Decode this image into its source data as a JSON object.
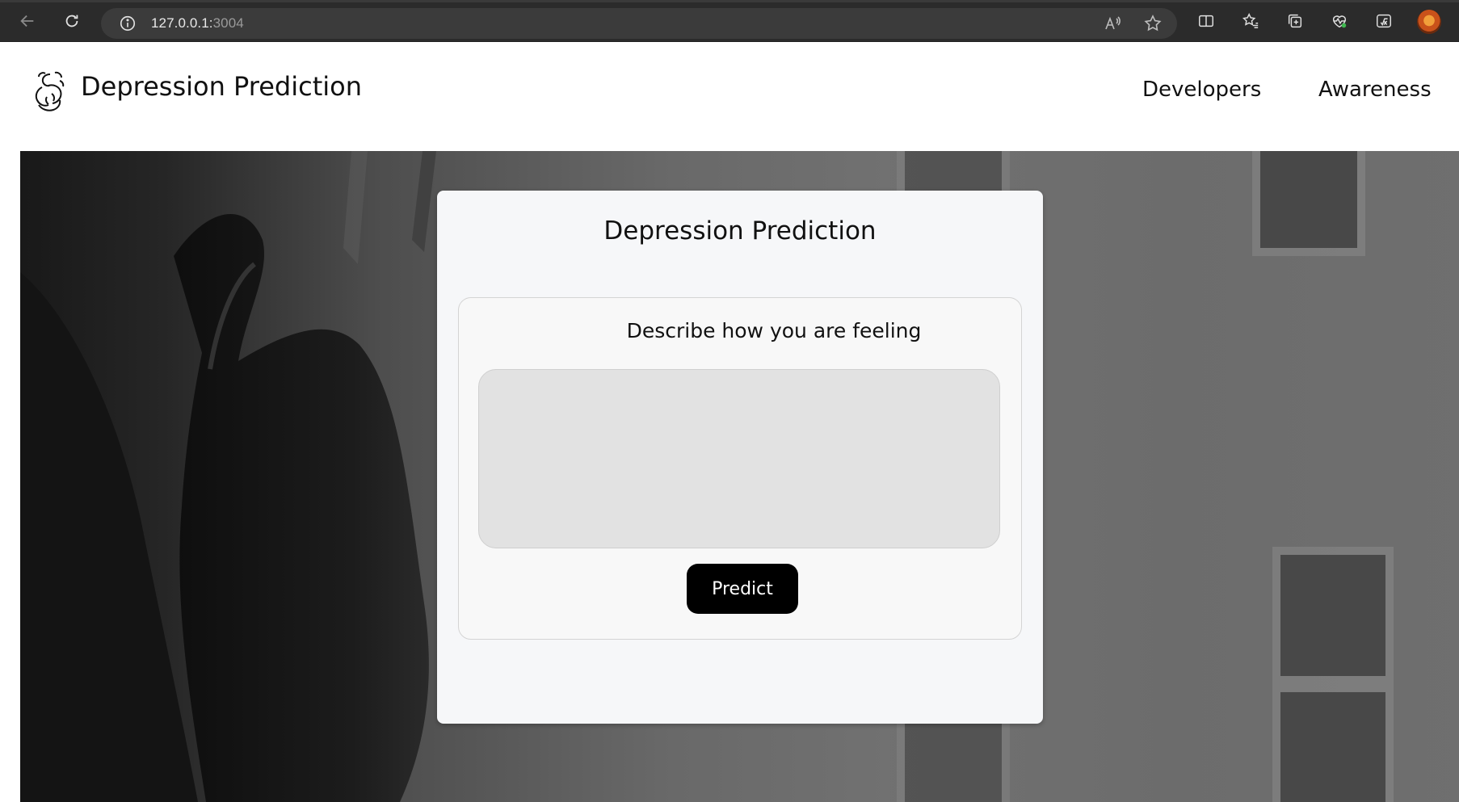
{
  "browser": {
    "url_host": "127.0.0.1:",
    "url_port": "3004",
    "icons": {
      "back": "back-arrow-icon",
      "reload": "reload-icon",
      "info": "info-icon",
      "read_aloud": "read-aloud-icon",
      "favorite": "star-icon",
      "split_screen": "split-screen-icon",
      "favorites": "favorites-icon",
      "collections": "collections-icon",
      "health": "browser-essentials-icon",
      "extension": "math-solver-icon",
      "profile": "profile-avatar"
    }
  },
  "header": {
    "brand": "Depression Prediction",
    "nav": [
      {
        "label": "Developers"
      },
      {
        "label": "Awareness"
      }
    ]
  },
  "card": {
    "title": "Depression Prediction",
    "form": {
      "label": "Describe how you are feeling",
      "input_value": "",
      "submit_label": "Predict"
    }
  },
  "colors": {
    "button_bg": "#000000",
    "card_bg": "#f6f7f9",
    "input_bg": "#e2e2e2"
  }
}
